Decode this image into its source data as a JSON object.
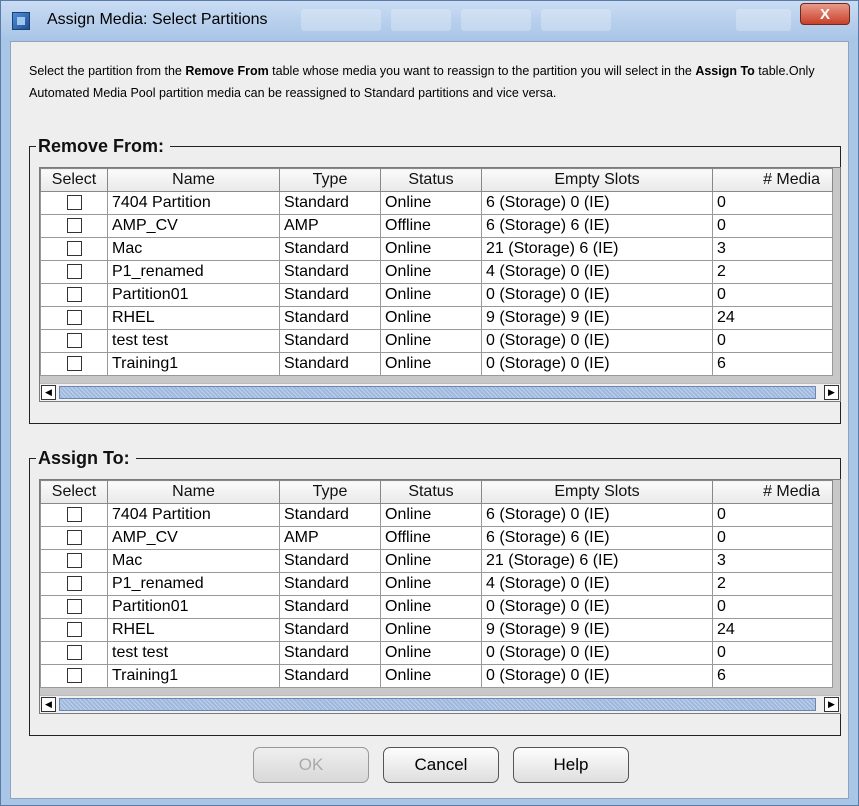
{
  "window": {
    "title": "Assign Media: Select Partitions",
    "close_glyph": "X"
  },
  "instructions": {
    "part1": "Select the partition from the ",
    "bold1": "Remove From",
    "part2": " table whose media you want to reassign to the partition you will select in the ",
    "bold2": "Assign To",
    "part3": " table.Only Automated Media Pool partition media can be reassigned to Standard partitions and vice versa."
  },
  "remove_from": {
    "title": "Remove From:",
    "columns": [
      "Select",
      "Name",
      "Type",
      "Status",
      "Empty Slots",
      "# Media"
    ],
    "rows": [
      {
        "name": "7404 Partition",
        "type": "Standard",
        "status": "Online",
        "slots": "6 (Storage) 0 (IE)",
        "media": "0"
      },
      {
        "name": "AMP_CV",
        "type": "AMP",
        "status": "Offline",
        "slots": "6 (Storage) 6 (IE)",
        "media": "0"
      },
      {
        "name": "Mac",
        "type": "Standard",
        "status": "Online",
        "slots": "21 (Storage) 6 (IE)",
        "media": "3"
      },
      {
        "name": "P1_renamed",
        "type": "Standard",
        "status": "Online",
        "slots": "4 (Storage) 0 (IE)",
        "media": "2"
      },
      {
        "name": "Partition01",
        "type": "Standard",
        "status": "Online",
        "slots": "0 (Storage) 0 (IE)",
        "media": "0"
      },
      {
        "name": "RHEL",
        "type": "Standard",
        "status": "Online",
        "slots": "9 (Storage) 9 (IE)",
        "media": "24"
      },
      {
        "name": "test test",
        "type": "Standard",
        "status": "Online",
        "slots": "0 (Storage) 0 (IE)",
        "media": "0"
      },
      {
        "name": "Training1",
        "type": "Standard",
        "status": "Online",
        "slots": "0 (Storage) 0 (IE)",
        "media": "6"
      }
    ]
  },
  "assign_to": {
    "title": "Assign To:",
    "columns": [
      "Select",
      "Name",
      "Type",
      "Status",
      "Empty Slots",
      "# Media"
    ],
    "rows": [
      {
        "name": "7404 Partition",
        "type": "Standard",
        "status": "Online",
        "slots": "6 (Storage) 0 (IE)",
        "media": "0"
      },
      {
        "name": "AMP_CV",
        "type": "AMP",
        "status": "Offline",
        "slots": "6 (Storage) 6 (IE)",
        "media": "0"
      },
      {
        "name": "Mac",
        "type": "Standard",
        "status": "Online",
        "slots": "21 (Storage) 6 (IE)",
        "media": "3"
      },
      {
        "name": "P1_renamed",
        "type": "Standard",
        "status": "Online",
        "slots": "4 (Storage) 0 (IE)",
        "media": "2"
      },
      {
        "name": "Partition01",
        "type": "Standard",
        "status": "Online",
        "slots": "0 (Storage) 0 (IE)",
        "media": "0"
      },
      {
        "name": "RHEL",
        "type": "Standard",
        "status": "Online",
        "slots": "9 (Storage) 9 (IE)",
        "media": "24"
      },
      {
        "name": "test test",
        "type": "Standard",
        "status": "Online",
        "slots": "0 (Storage) 0 (IE)",
        "media": "0"
      },
      {
        "name": "Training1",
        "type": "Standard",
        "status": "Online",
        "slots": "0 (Storage) 0 (IE)",
        "media": "6"
      }
    ]
  },
  "buttons": {
    "ok": "OK",
    "cancel": "Cancel",
    "help": "Help"
  },
  "scrollbar": {
    "left_arrow": "◀",
    "right_arrow": "▶"
  },
  "icons": [
    "app-icon",
    "close-icon",
    "scroll-left-icon",
    "scroll-right-icon"
  ],
  "colors": {
    "titlebar": "#aac6e6",
    "close_button": "#c9402a",
    "scroll_thumb": "#9fb8de",
    "client_bg": "#eeeeee"
  }
}
